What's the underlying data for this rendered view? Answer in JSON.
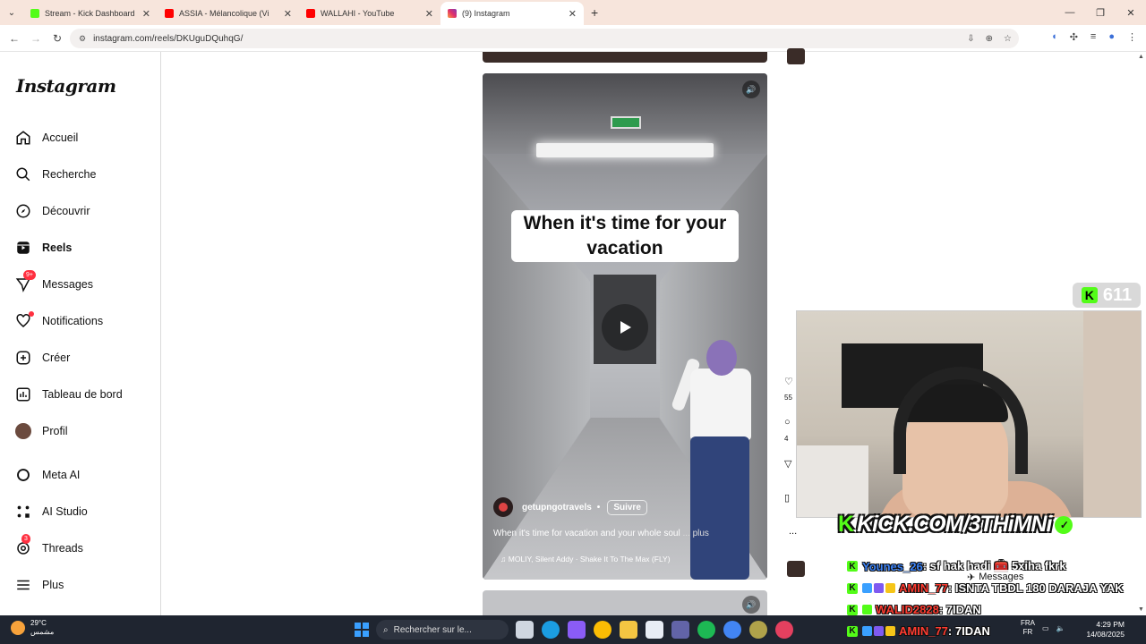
{
  "browser": {
    "tabs": [
      {
        "title": "Stream - Kick Dashboard",
        "color": "#53fc18"
      },
      {
        "title": "ASSIA - Mélancolique (Visu",
        "color": "#ff0000"
      },
      {
        "title": "WALLAHI - YouTube",
        "color": "#ff0000"
      },
      {
        "title": "(9) Instagram",
        "color": "#e1306c"
      }
    ],
    "active_tab": 3,
    "url": "instagram.com/reels/DKUguDQuhqG/"
  },
  "sidebar": {
    "logo": "Instagram",
    "items": [
      {
        "label": "Accueil",
        "icon": "home-icon"
      },
      {
        "label": "Recherche",
        "icon": "search-icon"
      },
      {
        "label": "Découvrir",
        "icon": "compass-icon"
      },
      {
        "label": "Reels",
        "icon": "reels-icon"
      },
      {
        "label": "Messages",
        "icon": "messenger-icon",
        "badge": "9+"
      },
      {
        "label": "Notifications",
        "icon": "heart-icon"
      },
      {
        "label": "Créer",
        "icon": "plus-square-icon"
      },
      {
        "label": "Tableau de bord",
        "icon": "chart-icon"
      },
      {
        "label": "Profil",
        "icon": "avatar-icon"
      },
      {
        "label": "Meta AI",
        "icon": "meta-ai-icon"
      },
      {
        "label": "AI Studio",
        "icon": "ai-studio-icon"
      },
      {
        "label": "Threads",
        "icon": "threads-icon",
        "badge": "3"
      },
      {
        "label": "Plus",
        "icon": "menu-icon"
      }
    ]
  },
  "reel": {
    "caption": "When it's time for your vacation",
    "username": "getupngotravels",
    "separator": "•",
    "follow_label": "Suivre",
    "description": "When it's time for vacation and your whole soul",
    "more_label": "... plus",
    "music": "MOLIY, Silent Addy · Shake It To The Max (FLY)"
  },
  "rail": {
    "likes": "55",
    "comments": "4",
    "more": "..."
  },
  "stream": {
    "viewers": "611",
    "kick_url": "KiCK.COM/3THiMNi",
    "chat": [
      {
        "user": "Younes_26",
        "text": ": sf hak hadi 🧰 5xiha fkrk",
        "user_color": "#3b82f6"
      },
      {
        "user": "AMIN_77",
        "text": ": ISNTA TBDL 180 DARAJA YAK",
        "user_color": "#ff3b30"
      },
      {
        "user": "WALID2828",
        "text": ": 7IDAN",
        "user_color": "#ff3b30"
      },
      {
        "user": "AMIN_77",
        "text": ": 7IDAN",
        "user_color": "#ff3b30"
      }
    ],
    "messages_chip": "Messages"
  },
  "taskbar": {
    "temperature": "29°C",
    "weather_label": "مشمس",
    "search_placeholder": "Rechercher sur le...",
    "lang_top": "FRA",
    "lang_bottom": "FR",
    "time": "4:29 PM",
    "date": "14/08/2025"
  }
}
